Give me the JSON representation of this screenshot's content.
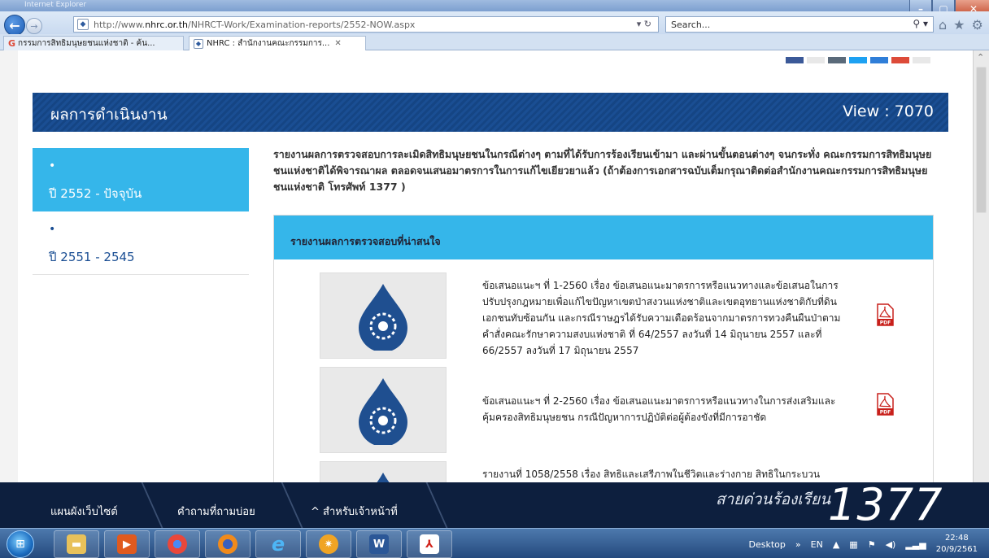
{
  "window": {
    "title": "Internet Explorer"
  },
  "address": {
    "url_prefix": "http://www.",
    "url_domain": "nhrc.or.th",
    "url_rest": "/NHRCT-Work/Examination-reports/2552-NOW.aspx",
    "search_placeholder": "Search..."
  },
  "tabs": [
    {
      "label": "กรรมการสิทธิมนุษยชนแห่งชาติ - ค้น...",
      "active": false
    },
    {
      "label": "NHRC : สำนักงานคณะกรรมการ...",
      "active": true
    }
  ],
  "header": {
    "title": "ผลการดำเนินงาน",
    "view": "View : 7070"
  },
  "sidebar": {
    "items": [
      {
        "bullet": "•",
        "label": "ปี 2552 - ปัจจุบัน",
        "active": true
      },
      {
        "bullet": "•",
        "label": "ปี 2551 - 2545",
        "active": false
      }
    ]
  },
  "intro": "รายงานผลการตรวจสอบการละเมิดสิทธิมนุษยชนในกรณีต่างๆ ตามที่ได้รับการร้องเรียนเข้ามา และผ่านขั้นตอนต่างๆ จนกระทั่ง คณะกรรมการสิทธิมนุษยชนแห่งชาติได้พิจารณาผล ตลอดจนเสนอมาตรการในการแก้ไขเยียวยาแล้ว (ถ้าต้องการเอกสารฉบับเต็มกรุณาติดต่อสำนักงานคณะกรรมการสิทธิมนุษยชนแห่งชาติ โทรศัพท์ 1377 )",
  "reports": {
    "heading": "รายงานผลการตรวจสอบที่น่าสนใจ",
    "items": [
      {
        "text": "ข้อเสนอแนะฯ ที่ 1-2560 เรื่อง ข้อเสนอแนะมาตรการหรือแนวทางและข้อเสนอในการปรับปรุงกฎหมายเพื่อแก้ไขปัญหาเขตป่าสงวนแห่งชาติและเขตอุทยานแห่งชาติกับที่ดินเอกชนทับซ้อนกัน และกรณีราษฎรได้รับความเดือดร้อนจากมาตรการทวงคืนผืนป่าตามคำสั่งคณะรักษาความสงบแห่งชาติ ที่ 64/2557 ลงวันที่ 14 มิถุนายน 2557 และที่ 66/2557 ลงวันที่ 17 มิถุนายน 2557",
        "pdf": "PDF"
      },
      {
        "text": "ข้อเสนอแนะฯ ที่ 2-2560 เรื่อง ข้อเสนอแนะมาตรการหรือแนวทางในการส่งเสริมและคุ้มครองสิทธิมนุษยชน กรณีปัญหาการปฏิบัติต่อผู้ต้องขังที่มีการอาชัด",
        "pdf": "PDF"
      },
      {
        "text": "รายงานที่ 1058/2558 เรื่อง สิทธิและเสรีภาพในชีวิตและร่างกาย สิทธิในกระบวน",
        "pdf": ""
      }
    ]
  },
  "footer": {
    "links": [
      "แผนผังเว็บไซต์",
      "คำถามที่ถามบ่อย",
      "^ สำหรับเจ้าหน้าที่"
    ],
    "hotline_label": "สายด่วนร้องเรียน",
    "hotline_number": "1377"
  },
  "taskbar": {
    "desktop_label": "Desktop",
    "lang": "EN",
    "time": "22:48",
    "date": "20/9/2561"
  },
  "colors": {
    "accent_blue": "#35b6ea",
    "header_navy": "#1a4e93",
    "footer_navy": "#0d1f3e"
  }
}
